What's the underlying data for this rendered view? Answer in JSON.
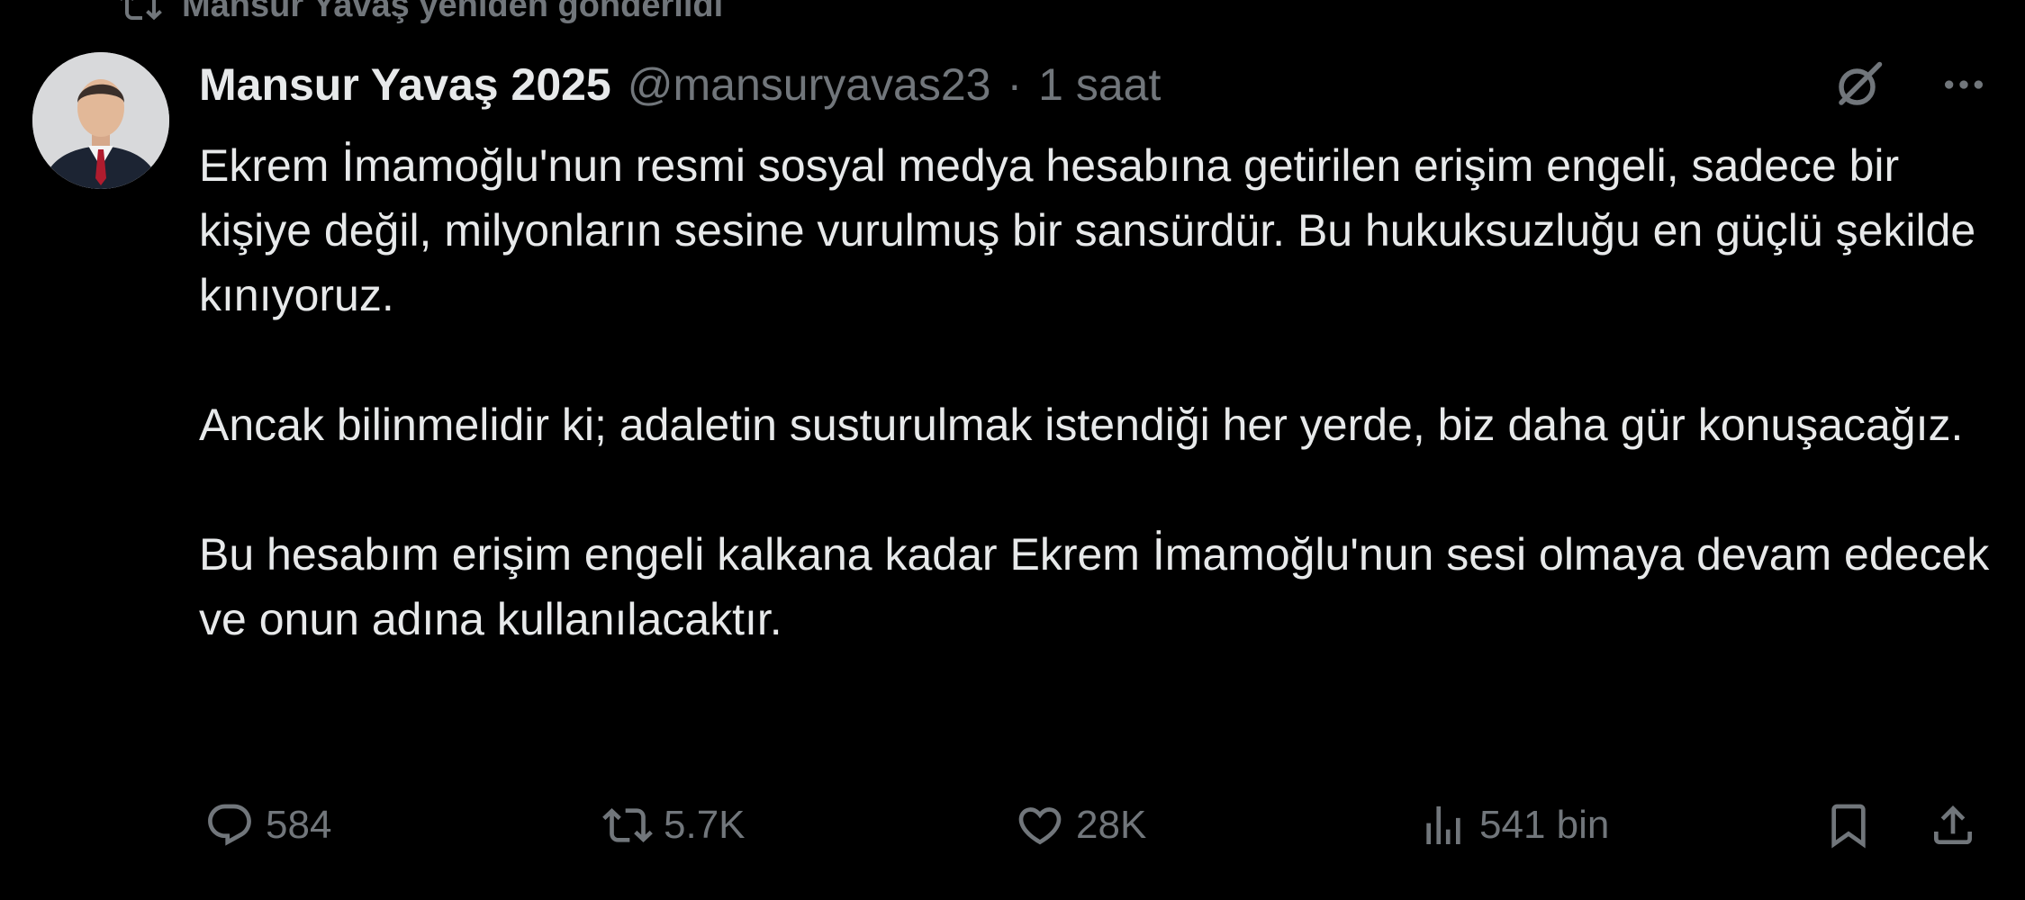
{
  "social_context": {
    "text": "Mansur Yavaş yeniden gönderildi",
    "icon": "retweet-icon"
  },
  "author": {
    "display_name": "Mansur Yavaş 2025",
    "handle": "@mansuryavas23",
    "separator": "·",
    "time": "1 saat",
    "avatar_icon": "avatar"
  },
  "top_actions": {
    "grok_icon": "grok-icon",
    "more_icon": "more-icon"
  },
  "tweet": {
    "paragraphs": [
      "Ekrem İmamoğlu'nun resmi sosyal medya hesabına getirilen erişim engeli, sadece bir kişiye değil, milyonların sesine vurulmuş bir sansürdür. Bu hukuksuzluğu en güçlü şekilde kınıyoruz.",
      "Ancak bilinmelidir ki; adaletin susturulmak istendiği her yerde, biz daha gür konuşacağız.",
      "Bu hesabım erişim engeli kalkana kadar Ekrem İmamoğlu'nun sesi olmaya devam edecek ve onun adına kullanılacaktır."
    ]
  },
  "actions": {
    "reply": {
      "icon": "reply-icon",
      "count": "584"
    },
    "repost": {
      "icon": "repost-icon",
      "count": "5.7K"
    },
    "like": {
      "icon": "heart-icon",
      "count": "28K"
    },
    "views": {
      "icon": "views-icon",
      "count": "541 bin"
    },
    "bookmark": {
      "icon": "bookmark-icon"
    },
    "share": {
      "icon": "share-icon"
    }
  },
  "colors": {
    "background": "#000000",
    "primary_text": "#e7e9ea",
    "secondary_text": "#71767b"
  }
}
